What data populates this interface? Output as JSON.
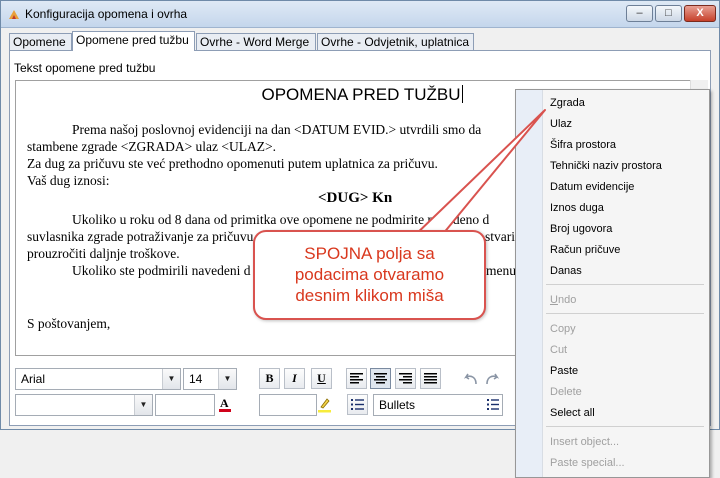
{
  "window": {
    "title": "Konfiguracija opomena i ovrha",
    "controls": {
      "minimize": "–",
      "maximize": "□",
      "close": "X"
    }
  },
  "tabs": [
    {
      "label": "Opomene"
    },
    {
      "label": "Opomene pred tužbu"
    },
    {
      "label": "Ovrhe - Word Merge"
    },
    {
      "label": "Ovrhe - Odvjetnik, uplatnica"
    }
  ],
  "panel_label": "Tekst opomene pred tužbu",
  "document": {
    "title": "OPOMENA PRED TUŽBU",
    "lines": [
      "Prema našoj poslovnoj evidenciji na dan <DATUM EVID.> utvrdili smo da",
      "stambene zgrade <ZGRADA>  ulaz <ULAZ>.",
      "Za dug za pričuvu ste već prethodno opomenuti putem uplatnica za pričuvu.",
      "Vaš dug iznosi:",
      "<DUG> Kn",
      "Ukoliko u roku od 8 dana od primitka ove opomene ne podmirite navedeno d",
      "suvlasnika zgrade potraživanje za pričuvu t",
      "stvariti u",
      "prouzročiti daljnje troškove.",
      "Ukoliko ste podmirili navedeni d",
      "menu",
      "S poštovanjem,"
    ]
  },
  "toolbar": {
    "font_name": "Arial",
    "font_size": "14",
    "style_value": "",
    "fill_value": "",
    "bold": "B",
    "italic": "I",
    "underline": "U",
    "list_combo": "Bullets"
  },
  "context_menu": {
    "fields": [
      "Zgrada",
      "Ulaz",
      "Šifra prostora",
      "Tehnički naziv prostora",
      "Datum evidencije",
      "Iznos duga",
      "Broj ugovora",
      "Račun pričuve",
      "Danas"
    ],
    "undo": "Undo",
    "edit": [
      {
        "label": "Copy",
        "enabled": false
      },
      {
        "label": "Cut",
        "enabled": false
      },
      {
        "label": "Paste",
        "enabled": true
      },
      {
        "label": "Delete",
        "enabled": false
      },
      {
        "label": "Select all",
        "enabled": true
      }
    ],
    "object": [
      "Insert object...",
      "Paste special..."
    ]
  },
  "callout": {
    "lines": [
      "SPOJNA polja sa",
      "podacima otvaramo",
      "desnim klikom miša"
    ],
    "color": "#d9381e"
  }
}
